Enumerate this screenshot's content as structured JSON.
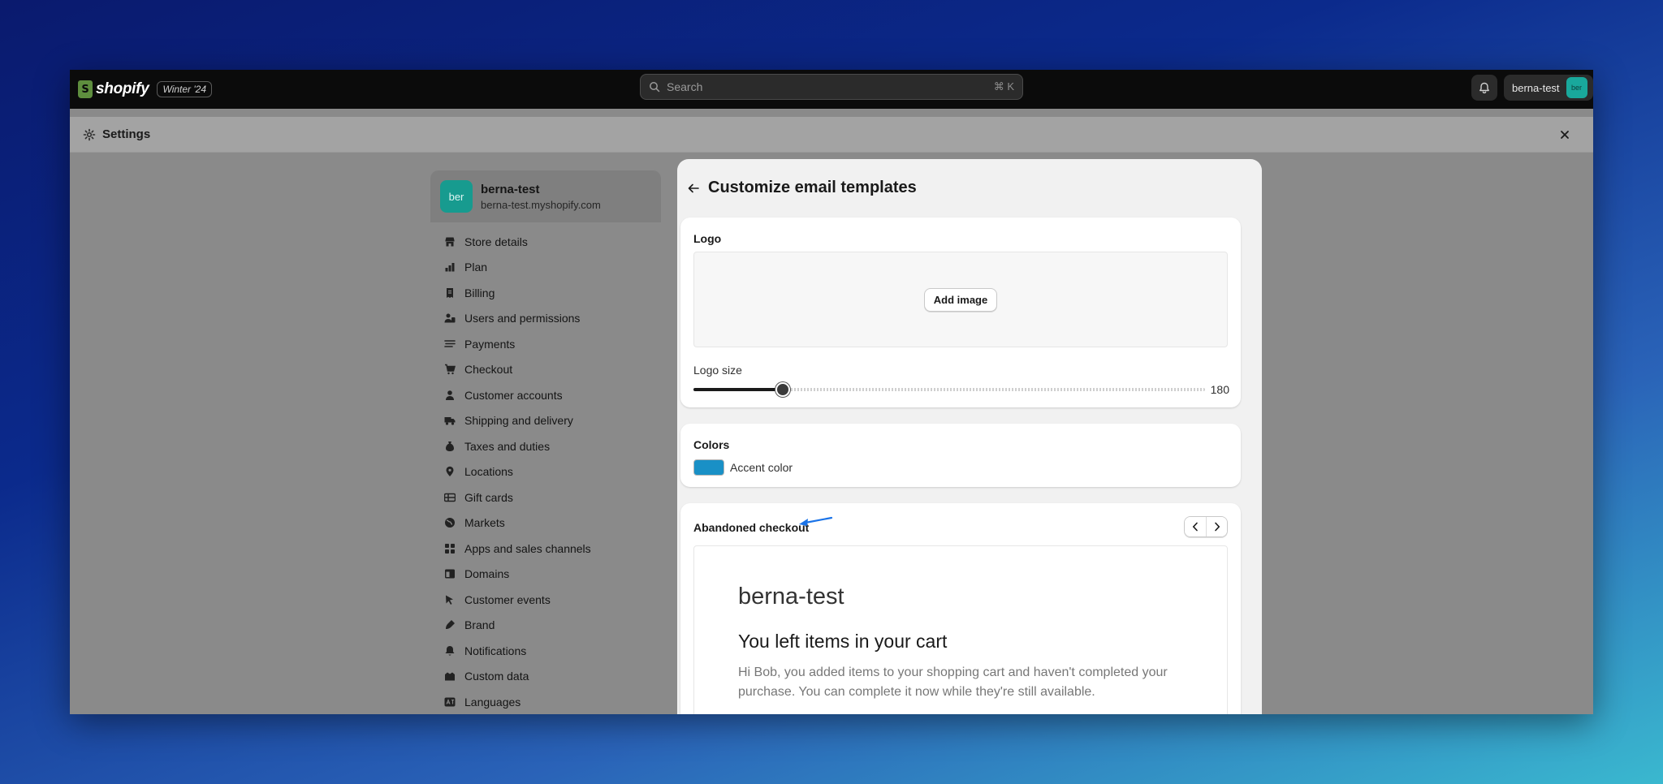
{
  "colors": {
    "accent": "#1990c6",
    "topbar": "#0b0b0b",
    "avatar": "#19a89c"
  },
  "topbar": {
    "brand_name": "shopify",
    "version_badge": "Winter '24",
    "search_placeholder": "Search",
    "search_shortcut": "⌘ K",
    "user_name": "berna-test",
    "user_initials": "ber"
  },
  "settings": {
    "title": "Settings"
  },
  "sidebar": {
    "store": {
      "initials": "ber",
      "name": "berna-test",
      "url": "berna-test.myshopify.com"
    },
    "items": [
      {
        "label": "Store details",
        "icon": "store-icon"
      },
      {
        "label": "Plan",
        "icon": "plan-icon"
      },
      {
        "label": "Billing",
        "icon": "billing-icon"
      },
      {
        "label": "Users and permissions",
        "icon": "users-icon"
      },
      {
        "label": "Payments",
        "icon": "payments-icon"
      },
      {
        "label": "Checkout",
        "icon": "cart-icon"
      },
      {
        "label": "Customer accounts",
        "icon": "person-icon"
      },
      {
        "label": "Shipping and delivery",
        "icon": "truck-icon"
      },
      {
        "label": "Taxes and duties",
        "icon": "tax-icon"
      },
      {
        "label": "Locations",
        "icon": "location-icon"
      },
      {
        "label": "Gift cards",
        "icon": "gift-card-icon"
      },
      {
        "label": "Markets",
        "icon": "globe-icon"
      },
      {
        "label": "Apps and sales channels",
        "icon": "apps-icon"
      },
      {
        "label": "Domains",
        "icon": "domains-icon"
      },
      {
        "label": "Customer events",
        "icon": "events-icon"
      },
      {
        "label": "Brand",
        "icon": "brand-icon"
      },
      {
        "label": "Notifications",
        "icon": "bell-icon"
      },
      {
        "label": "Custom data",
        "icon": "custom-data-icon"
      },
      {
        "label": "Languages",
        "icon": "languages-icon"
      }
    ]
  },
  "panel": {
    "title": "Customize email templates",
    "logo": {
      "title": "Logo",
      "add_image_label": "Add image",
      "size_label": "Logo size",
      "size_value": "180",
      "size_fraction": 0.175
    },
    "colors": {
      "title": "Colors",
      "accent_label": "Accent color"
    },
    "preview": {
      "title": "Abandoned checkout",
      "store_name": "berna-test",
      "heading": "You left items in your cart",
      "body": "Hi Bob, you added items to your shopping cart and haven't completed your purchase. You can complete it now while they're still available."
    }
  }
}
